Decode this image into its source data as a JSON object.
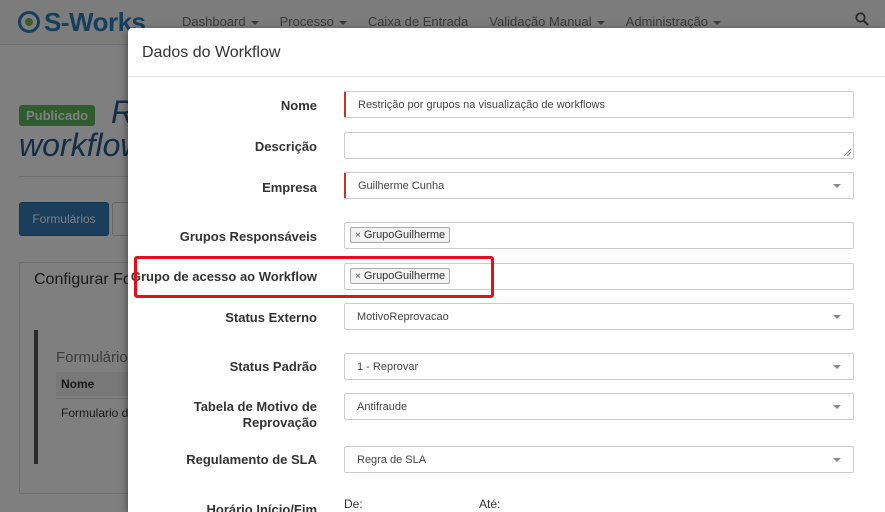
{
  "app": {
    "logo_text": "S-Works",
    "nav": [
      {
        "label": "Dashboard",
        "dropdown": true
      },
      {
        "label": "Processo",
        "dropdown": true
      },
      {
        "label": "Caixa de Entrada",
        "dropdown": false
      },
      {
        "label": "Validação Manual",
        "dropdown": true
      },
      {
        "label": "Administração",
        "dropdown": true
      }
    ],
    "status_badge": "Publicado",
    "page_title_line1": "R",
    "page_title_line2": "workflow",
    "formularios_button": "Formulários",
    "panel_title": "Configurar Fo",
    "inner_title": "Formulário",
    "inner_col_header": "Nome",
    "inner_row_value": "Formulario de"
  },
  "modal": {
    "title": "Dados do Workflow",
    "fields": {
      "nome": {
        "label": "Nome",
        "value": "Restrição por grupos na visualização de workflows"
      },
      "descricao": {
        "label": "Descrição",
        "value": ""
      },
      "empresa": {
        "label": "Empresa",
        "value": "Guilherme Cunha"
      },
      "grupos_responsaveis": {
        "label": "Grupos Responsáveis",
        "tags": [
          "GrupoGuilherme"
        ]
      },
      "grupo_acesso": {
        "label": "Grupo de acesso ao Workflow",
        "tags": [
          "GrupoGuilherme"
        ]
      },
      "status_externo": {
        "label": "Status Externo",
        "value": "MotivoReprovacao"
      },
      "status_padrao": {
        "label": "Status Padrão",
        "value": "1 - Reprovar"
      },
      "tabela_motivo": {
        "label_line1": "Tabela de Motivo de",
        "label_line2": "Reprovação",
        "value": "Antifraude"
      },
      "regulamento_sla": {
        "label": "Regulamento de SLA",
        "value": "Regra de SLA"
      },
      "horario": {
        "label": "Horário Início/Fim",
        "de_label": "De:",
        "ate_label": "Até:"
      }
    },
    "tag_remove_symbol": "×"
  },
  "colors": {
    "brand": "#2a7fb8",
    "required_marker": "#c9302c",
    "highlight": "#e3101c",
    "badge": "#5cb85c"
  }
}
